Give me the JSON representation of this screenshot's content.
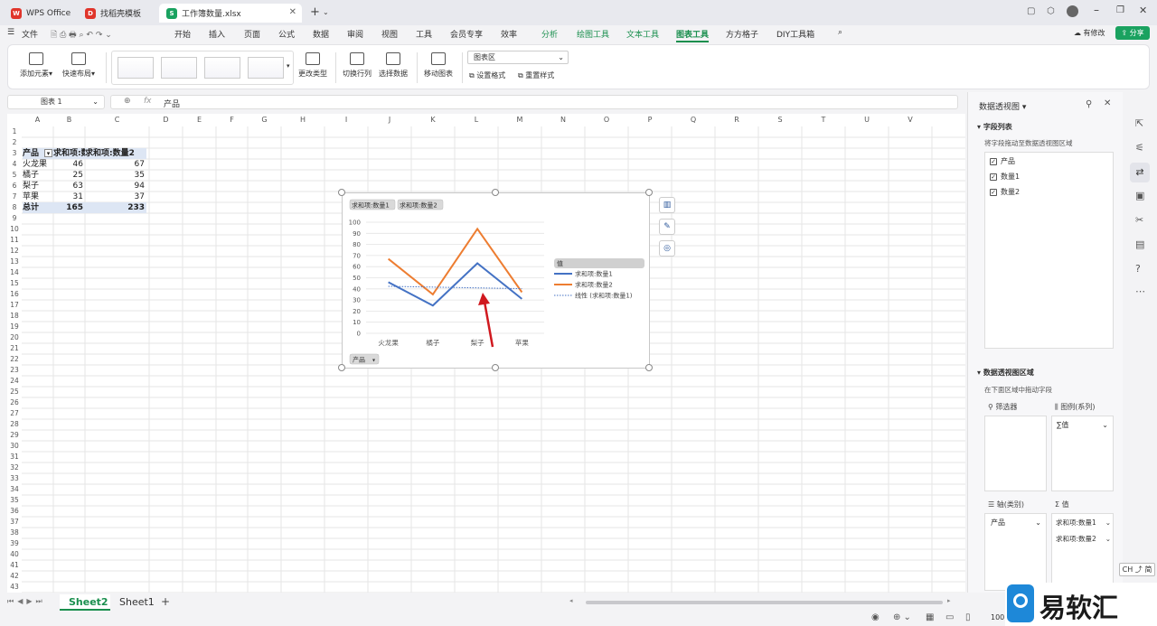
{
  "tabs": [
    {
      "label": "WPS Office"
    },
    {
      "label": "找稻壳模板"
    },
    {
      "label": "工作簿数量.xlsx"
    }
  ],
  "menu": {
    "file": "文件",
    "items": [
      "开始",
      "插入",
      "页面",
      "公式",
      "数据",
      "审阅",
      "视图",
      "工具",
      "会员专享",
      "效率",
      "分析",
      "绘图工具",
      "文本工具",
      "图表工具",
      "方方格子",
      "DIY工具箱"
    ],
    "edit_label": "有修改",
    "share_label": "分享"
  },
  "ribbon": {
    "add_element": "添加元素",
    "quick_layout": "快速布局",
    "change_type": "更改类型",
    "switch_rowcol": "切换行列",
    "select_data": "选择数据",
    "move_chart": "移动图表",
    "chart_area_select": "图表区",
    "set_format": "设置格式",
    "reset_style": "重置样式"
  },
  "formula": {
    "name_box": "图表 1",
    "fx": "fx",
    "content": "产品"
  },
  "columns": [
    "A",
    "B",
    "C",
    "D",
    "E",
    "F",
    "G",
    "H",
    "I",
    "J",
    "K",
    "L",
    "M",
    "N",
    "O",
    "P",
    "Q",
    "R",
    "S",
    "T",
    "U",
    "V"
  ],
  "rows": [
    "1",
    "2",
    "3",
    "4",
    "5",
    "6",
    "7",
    "8",
    "9",
    "10",
    "11",
    "12",
    "13",
    "14",
    "15",
    "16",
    "17",
    "18",
    "19",
    "20",
    "21",
    "22",
    "23",
    "24",
    "25",
    "26",
    "27",
    "28",
    "29",
    "30",
    "31",
    "32",
    "33",
    "34",
    "35",
    "36",
    "37",
    "38",
    "39",
    "40",
    "41",
    "42",
    "43"
  ],
  "pivot": {
    "header": [
      "产品",
      "求和项:数量1",
      "求和项:数量2"
    ],
    "rows": [
      {
        "name": "火龙果",
        "q1": "46",
        "q2": "67"
      },
      {
        "name": "橘子",
        "q1": "25",
        "q2": "35"
      },
      {
        "name": "梨子",
        "q1": "63",
        "q2": "94"
      },
      {
        "name": "苹果",
        "q1": "31",
        "q2": "37"
      }
    ],
    "total": {
      "name": "总计",
      "q1": "165",
      "q2": "233"
    }
  },
  "chart_data": {
    "type": "line",
    "categories": [
      "火龙果",
      "橘子",
      "梨子",
      "苹果"
    ],
    "series": [
      {
        "name": "求和项:数量1",
        "values": [
          46,
          25,
          63,
          31
        ],
        "color": "#4472c4"
      },
      {
        "name": "求和项:数量2",
        "values": [
          67,
          35,
          94,
          37
        ],
        "color": "#ed7d31"
      }
    ],
    "trendline": {
      "name": "线性 (求和项:数量1)",
      "series": "求和项:数量1",
      "color": "#4472c4"
    },
    "ylim": [
      0,
      100
    ],
    "yticks": [
      "0",
      "10",
      "20",
      "30",
      "40",
      "50",
      "60",
      "70",
      "80",
      "90",
      "100"
    ],
    "field_buttons": [
      "求和项:数量1",
      "求和项:数量2"
    ],
    "legend_title": "值",
    "axis_field": "产品",
    "legend_position": "right",
    "grid": true
  },
  "panel": {
    "title": "数据透视图",
    "field_list": "字段列表",
    "drag_hint": "将字段拖动至数据透视图区域",
    "fields": [
      "产品",
      "数量1",
      "数量2"
    ],
    "areas_title": "数据透视图区域",
    "areas_hint": "在下面区域中拖动字段",
    "filter": "筛选器",
    "legend": "图例(系列)",
    "legend_value": "∑值",
    "axis": "轴(类别)",
    "values": "值",
    "axis_value": "产品",
    "value_items": [
      "求和项:数量1",
      "求和项:数量2"
    ]
  },
  "sheets": [
    "Sheet2",
    "Sheet1"
  ],
  "status": {
    "zoom": "100"
  },
  "ime": "CH ⤴ 简",
  "watermark": "易软汇"
}
